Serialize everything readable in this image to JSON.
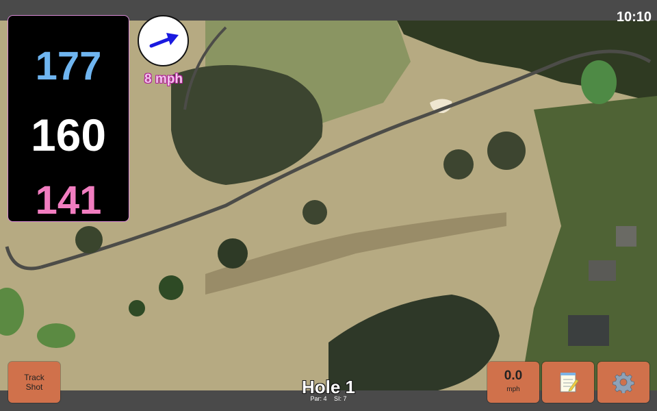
{
  "status_bar": {
    "time": "10:10"
  },
  "distances": {
    "back": "177",
    "middle": "160",
    "front": "141"
  },
  "wind": {
    "speed": "8 mph",
    "direction_icon": "wind-arrow-icon"
  },
  "buttons": {
    "track_line1": "Track",
    "track_line2": "Shot",
    "speed_value": "0.0",
    "speed_unit": "mph",
    "notes_icon": "notepad-icon",
    "settings_icon": "gear-icon"
  },
  "hole": {
    "title": "Hole 1",
    "par": "Par: 4",
    "stroke_index": "SI: 7"
  },
  "colors": {
    "back_distance": "#6fb5f0",
    "middle_distance": "#ffffff",
    "front_distance": "#f17dc0",
    "button": "#d0714b",
    "wind_arrow": "#1a1ae0"
  }
}
